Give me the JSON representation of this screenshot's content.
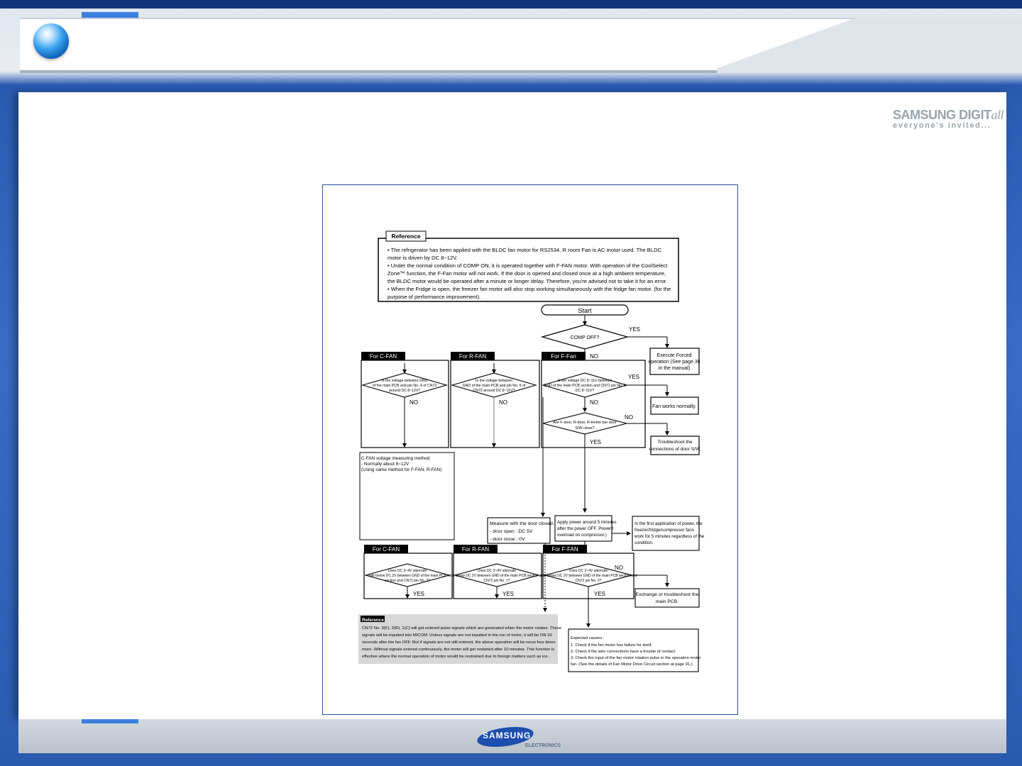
{
  "brand": {
    "main": "SAMSUNG DIGIT",
    "main_suffix": "all",
    "tagline": "everyone's invited..."
  },
  "footer": {
    "logo": "SAMSUNG",
    "logo_sub": "ELECTRONICS"
  },
  "colors": {
    "header_band": "#12357a",
    "page_bg": "#2f64b8",
    "frame_border": "#2a4fa0",
    "accent": "#3b7fe0"
  },
  "reference": {
    "title": "Reference",
    "lines": [
      "•  The refrigerator has been applied with the BLDC fan motor for RS2534. R room Fan is AC motor used. The BLDC",
      "    motor is driven by DC 8~12V.",
      "•  Under the normal condition of COMP ON, it is operated together with F-FAN motor. With operation of the CoolSelect",
      "    Zone™ function, the F-Fan motor will not work. If the door is opened and closed once at a high ambient  temperature,",
      "    the BLDC motor would be operated after a minute or longer delay. Therefore, you're advised not to take it for an error.",
      "•  When the Fridge is open, the freezer fan motor will also stop working simultaneously with the fridge fan motor. (for the",
      "    purpose of performance improvement)."
    ]
  },
  "flow": {
    "start": "Start",
    "comp_off": "COMP OFF?",
    "yes": "YES",
    "no": "NO",
    "execute_forced": [
      "Execute Forced",
      "operation (See page 36",
      "in the manual)"
    ],
    "fan_works": "Fan works normally.",
    "troubleshoot_door": [
      "Troubleshoot the",
      "connections of door S/W."
    ],
    "tab_cfan": "For C-FAN",
    "tab_rfan": "For R-FAN",
    "tab_ffan": "For F-Fan",
    "tab_ffan2": "For F-FAN",
    "q_cfan": [
      "Is the voltage between GND",
      "of the main PCB and pin No. 4 of CN72",
      "around DC 8~12V?"
    ],
    "q_rfan": [
      "Is the voltage between",
      "GND of the main PCB and pin No. 5 of",
      "CN72 around DC 8~11V?"
    ],
    "q_ffan": [
      "Is the voltage DC 8~11V between",
      "GND of the main PCB section and CN71 pin No. 6",
      "DC 8~11V?"
    ],
    "q_door": [
      "Are F-door, R-door, R-Home bar door",
      "S/W close?"
    ],
    "measure_note": [
      "C-FAN voltage measuring method",
      "- Normally about 8~12V",
      "  (Using same method for F-FAN, R-FAN)"
    ],
    "measure_closed": [
      "Measure with the door closed.",
      "- door open : DC 5V",
      "- door close : 0V"
    ],
    "apply_power": [
      "Apply power around 5 minutes",
      "after the power OFF. Prevent",
      "overload on compressor.)"
    ],
    "first_app": [
      "In the first application of power, the",
      "freezer/fridge/compressor fans",
      "work for 5 minutes regardless of the",
      "condition."
    ],
    "q2_cfan": [
      "Does DC 3~4V alternate",
      "with below DC 2V between GND of the main PCB",
      "section and CN72 pin No. 2?"
    ],
    "q2_rfan": [
      "Does DC 3~4V alternate",
      "with below DC 2V between GND of the main PCB section and",
      "CN72 pin No. 1?"
    ],
    "q2_ffan": [
      "Does DC 3~4V alternate",
      "with below DC 2V between GND of the main PCB section and",
      "CN72 pin No. 3?"
    ],
    "exchange": [
      "Exchange or troubleshoot the",
      "main PCB."
    ],
    "expected": [
      "Expected causes :",
      "1. Check if the fan motor has failure for itself.",
      "2. Check if the wire connections have a trouble of contact.",
      "3. Check the input of the fan motor rotation pulse in the operation motor",
      "    fan. (See the details of Fan Motor Drive Circuit section at page 91.)"
    ]
  },
  "reference2": {
    "title": "Reference",
    "lines": [
      "CN72 No. 3(F), 2(R), 1(C) will get entered pulse signals which are generated when the motor rotates. These",
      "signals will be inputted into MICOM. Unless signals are not inputted in the run of motor, it will be ON 10",
      "seconds after the fan OFF. But if signals are not still entered, the  above operation will be rerun four times",
      "more. Without signals entered continuously, the motor will get restarted after 10 minutes. This function is",
      "effective where the normal operation of motor would be restrained due to foreign matters such as ice."
    ]
  }
}
